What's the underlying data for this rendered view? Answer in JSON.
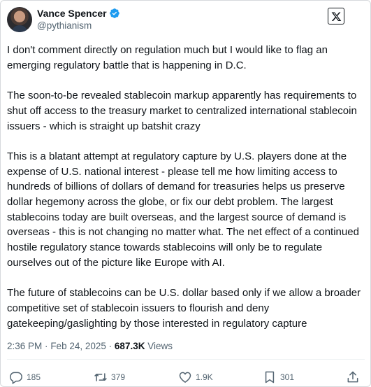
{
  "author": {
    "display_name": "Vance Spencer",
    "handle": "@pythianism",
    "avatar_icon": "avatar-photo",
    "verified_icon": "verified-badge-icon"
  },
  "colors": {
    "verified": "#1d9bf0",
    "secondary_text": "#536471",
    "primary_text": "#0f1419"
  },
  "post": {
    "paragraphs": [
      "I don't comment directly on regulation much but I would like to flag an emerging regulatory battle that is happening in D.C.",
      "The soon-to-be revealed stablecoin markup apparently has requirements to shut off access to the treasury market to centralized international stablecoin issuers - which is straight up batshit crazy",
      "This is a blatant attempt at regulatory capture by U.S. players done at the expense of U.S. national interest - please tell me how limiting access to hundreds of billions of dollars of demand for treasuries helps us preserve dollar hegemony across the globe, or fix our debt problem. The largest stablecoins today are built overseas, and the largest source of demand is overseas - this is not changing no matter what. The net effect of a continued hostile regulatory stance towards stablecoins will only be to regulate ourselves out of the picture like Europe with AI.",
      "The future of stablecoins can be U.S. dollar based only if we allow a broader competitive set of stablecoin issuers to flourish and deny gatekeeping/gaslighting by those interested in regulatory capture"
    ]
  },
  "meta": {
    "time": "2:36 PM",
    "separator": "·",
    "date": "Feb 24, 2025",
    "views_count": "687.3K",
    "views_label": "Views"
  },
  "actions": {
    "replies": "185",
    "reposts": "379",
    "likes": "1.9K",
    "bookmarks": "301"
  }
}
